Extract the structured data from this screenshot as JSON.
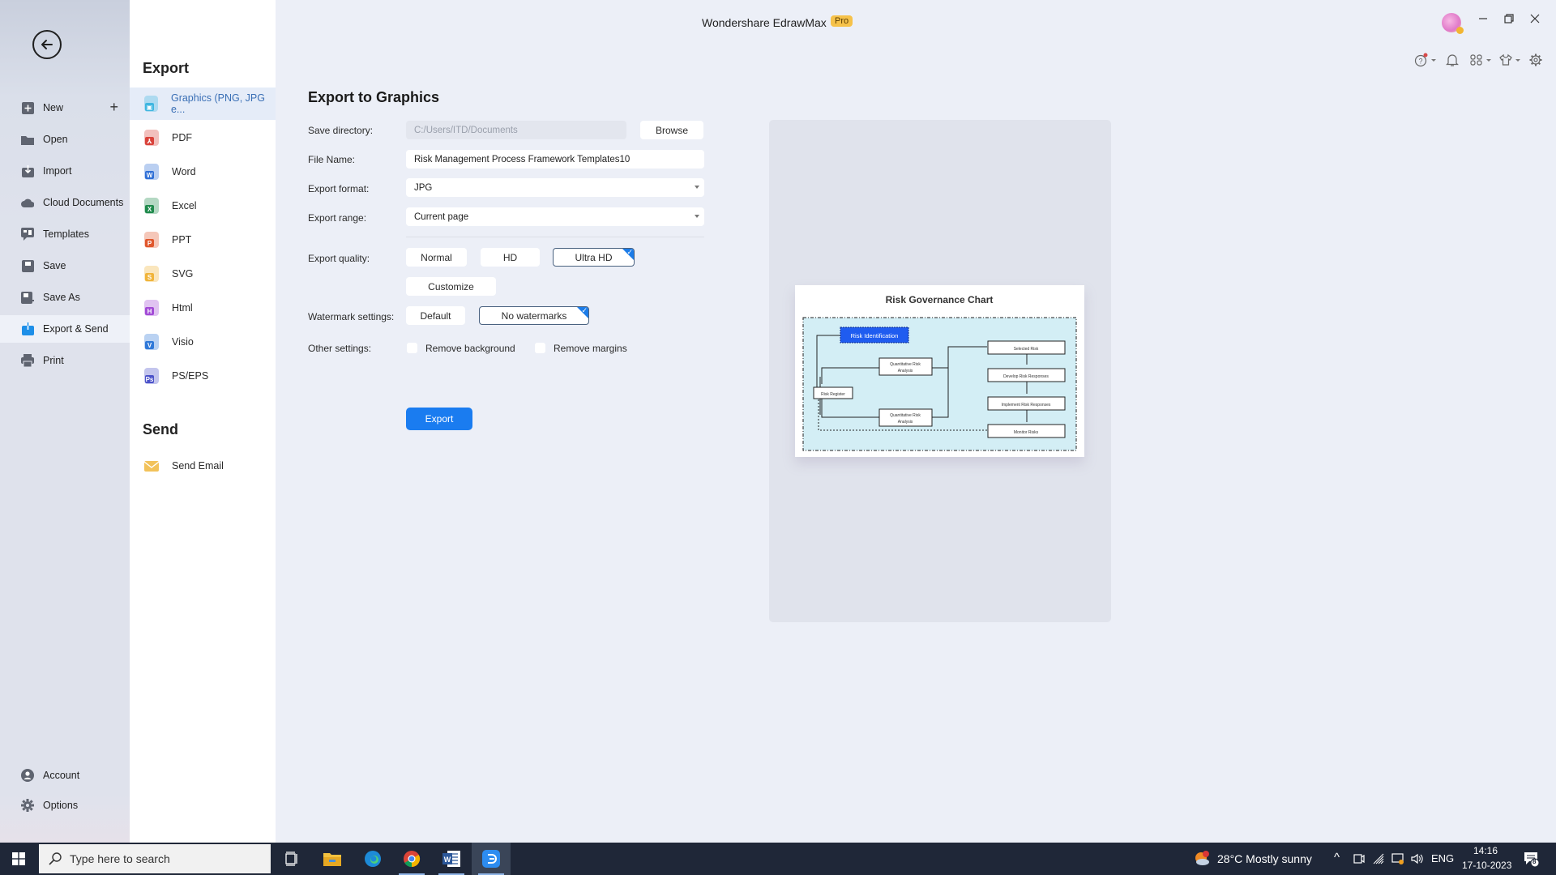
{
  "app": {
    "title": "Wondershare EdrawMax",
    "badge": "Pro"
  },
  "nav": {
    "items": [
      {
        "label": "New",
        "icon": "plus-square-icon"
      },
      {
        "label": "Open",
        "icon": "folder-icon"
      },
      {
        "label": "Import",
        "icon": "import-icon"
      },
      {
        "label": "Cloud Documents",
        "icon": "cloud-icon"
      },
      {
        "label": "Templates",
        "icon": "templates-icon"
      },
      {
        "label": "Save",
        "icon": "save-icon"
      },
      {
        "label": "Save As",
        "icon": "save-as-icon"
      },
      {
        "label": "Export & Send",
        "icon": "export-icon",
        "active": true
      },
      {
        "label": "Print",
        "icon": "print-icon"
      }
    ],
    "bottom": [
      {
        "label": "Account",
        "icon": "account-icon"
      },
      {
        "label": "Options",
        "icon": "gear-icon"
      }
    ]
  },
  "export_menu": {
    "export_heading": "Export",
    "items": [
      {
        "label": "Graphics (PNG, JPG e...",
        "color": "#3fb6e0",
        "glyph": "▣",
        "active": true
      },
      {
        "label": "PDF",
        "color": "#d9423a",
        "glyph": "⅄"
      },
      {
        "label": "Word",
        "color": "#2f6fd6",
        "glyph": "W"
      },
      {
        "label": "Excel",
        "color": "#1f8a4c",
        "glyph": "X"
      },
      {
        "label": "PPT",
        "color": "#e0572c",
        "glyph": "P"
      },
      {
        "label": "SVG",
        "color": "#f0b43a",
        "glyph": "S"
      },
      {
        "label": "Html",
        "color": "#a24bd6",
        "glyph": "H"
      },
      {
        "label": "Visio",
        "color": "#2f78d8",
        "glyph": "V"
      },
      {
        "label": "PS/EPS",
        "color": "#4b52c9",
        "glyph": "Ps"
      }
    ],
    "send_heading": "Send",
    "send_items": [
      {
        "label": "Send Email",
        "color": "#f2c25a"
      }
    ]
  },
  "form": {
    "title": "Export to Graphics",
    "save_directory": {
      "label": "Save directory:",
      "value": "C:/Users/ITD/Documents",
      "browse": "Browse"
    },
    "file_name": {
      "label": "File Name:",
      "value": "Risk Management Process Framework Templates10"
    },
    "export_format": {
      "label": "Export format:",
      "value": "JPG"
    },
    "export_range": {
      "label": "Export range:",
      "value": "Current page"
    },
    "export_quality": {
      "label": "Export quality:",
      "options": [
        "Normal",
        "HD",
        "Ultra HD",
        "Customize"
      ],
      "selected": "Ultra HD"
    },
    "watermark": {
      "label": "Watermark settings:",
      "options": [
        "Default",
        "No watermarks"
      ],
      "selected": "No watermarks"
    },
    "other": {
      "label": "Other settings:",
      "remove_background": {
        "label": "Remove background",
        "checked": false
      },
      "remove_margins": {
        "label": "Remove margins",
        "checked": false
      }
    },
    "export_button": "Export"
  },
  "preview": {
    "diagram_title": "Risk Governance Chart",
    "nodes": {
      "risk_identification": "Risk Identification",
      "risk_register": "Risk Register",
      "qra_top_1": "Quantitative Risk",
      "qra_top_2": "Analysis",
      "qra_bottom_1": "Quantitative Risk",
      "qra_bottom_2": "Analysis",
      "selected_risk": "Selected Risk",
      "develop": "Develop Risk Responses",
      "implement": "Implement Risk Responses",
      "monitor": "Monitor Risks"
    }
  },
  "taskbar": {
    "search_placeholder": "Type here to search",
    "weather": "28°C  Mostly sunny",
    "language": "ENG",
    "time": "14:16",
    "date": "17-10-2023",
    "notifications": "8"
  }
}
